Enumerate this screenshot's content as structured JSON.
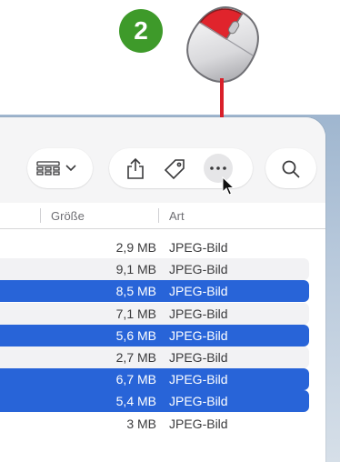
{
  "step": {
    "number": "2"
  },
  "toolbar": {
    "view_icon": "grid-view-icon",
    "chevron_icon": "chevron-down-icon",
    "share_icon": "share-icon",
    "tag_icon": "tag-icon",
    "more_icon": "more-ellipsis-icon",
    "search_icon": "search-icon"
  },
  "columns": {
    "size": "Größe",
    "kind": "Art"
  },
  "rows": [
    {
      "size": "2,9 MB",
      "kind": "JPEG-Bild",
      "selected": false
    },
    {
      "size": "9,1 MB",
      "kind": "JPEG-Bild",
      "selected": false
    },
    {
      "size": "8,5 MB",
      "kind": "JPEG-Bild",
      "selected": true
    },
    {
      "size": "7,1 MB",
      "kind": "JPEG-Bild",
      "selected": false
    },
    {
      "size": "5,6 MB",
      "kind": "JPEG-Bild",
      "selected": true
    },
    {
      "size": "2,7 MB",
      "kind": "JPEG-Bild",
      "selected": false
    },
    {
      "size": "6,7 MB",
      "kind": "JPEG-Bild",
      "selected": true
    },
    {
      "size": "5,4 MB",
      "kind": "JPEG-Bild",
      "selected": true
    },
    {
      "size": "3 MB",
      "kind": "JPEG-Bild",
      "selected": false
    }
  ],
  "colors": {
    "selection": "#2864d8",
    "badge": "#3e9a2a",
    "arrow": "#d9202a",
    "mouse_button": "#e0242c"
  }
}
